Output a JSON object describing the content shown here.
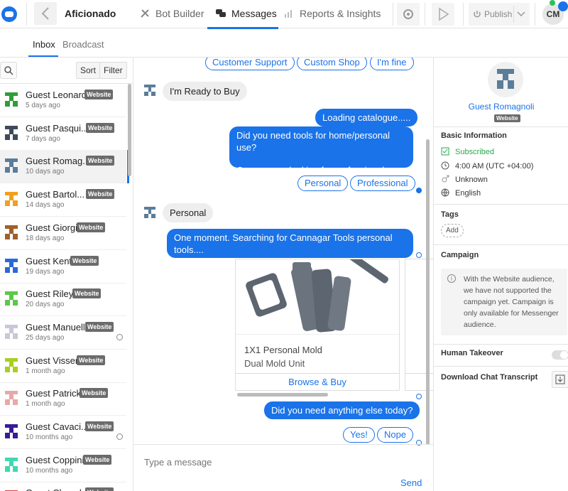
{
  "topbar": {
    "app_name": "Aficionado",
    "nav": [
      "Bot Builder",
      "Messages",
      "Reports & Insights"
    ],
    "publish_label": "Publish",
    "user_initials": "CM"
  },
  "subtabs": [
    "Inbox",
    "Broadcast"
  ],
  "list_tools": {
    "sort": "Sort",
    "filter": "Filter"
  },
  "conversations": [
    {
      "name": "Guest Leonard",
      "badge": "Website",
      "time": "5 days ago",
      "color": "#2e9e3a"
    },
    {
      "name": "Guest Pasqui...",
      "badge": "Website",
      "time": "7 days ago",
      "color": "#3f4a5c"
    },
    {
      "name": "Guest Romag...",
      "badge": "Website",
      "time": "10 days ago",
      "color": "#5a7d9a"
    },
    {
      "name": "Guest Bartol...",
      "badge": "Website",
      "time": "14 days ago",
      "color": "#f0a020"
    },
    {
      "name": "Guest Giorgi",
      "badge": "Website",
      "time": "18 days ago",
      "color": "#a0602a"
    },
    {
      "name": "Guest Kent",
      "badge": "Website",
      "time": "19 days ago",
      "color": "#2a6ad8"
    },
    {
      "name": "Guest Riley",
      "badge": "Website",
      "time": "20 days ago",
      "color": "#5cc84a"
    },
    {
      "name": "Guest Manuelli",
      "badge": "Website",
      "time": "25 days ago",
      "color": "#c8c8d8"
    },
    {
      "name": "Guest Visser",
      "badge": "Website",
      "time": "1 month ago",
      "color": "#a8d020"
    },
    {
      "name": "Guest Patrick",
      "badge": "Website",
      "time": "1 month ago",
      "color": "#e8a8a8"
    },
    {
      "name": "Guest Cavaci...",
      "badge": "Website",
      "time": "10 months ago",
      "color": "#3a1a9a"
    },
    {
      "name": "Guest Coppini",
      "badge": "Website",
      "time": "10 months ago",
      "color": "#40d8b0"
    },
    {
      "name": "Guest Cheval...",
      "badge": "Website",
      "time": "",
      "color": "#d84040"
    }
  ],
  "chat": {
    "top_replies": [
      "Customer Support",
      "Custom Shop",
      "I'm fine"
    ],
    "msg_ready": "I'm Ready to Buy",
    "out1": "Loading catalogue.....",
    "out2a": "Did you need tools for home/personal use?",
    "out2b": "Or were you looking for professional tools?",
    "replies2": [
      "Personal",
      "Professional"
    ],
    "msg_personal": "Personal",
    "out3": "One moment. Searching for Cannagar Tools personal tools....",
    "card": {
      "title": "1X1 Personal Mold",
      "subtitle": "Dual Mold Unit",
      "button": "Browse & Buy"
    },
    "out4": "Did you need anything else today?",
    "replies3": [
      "Yes!",
      "Nope"
    ],
    "placeholder": "Type a message",
    "send": "Send"
  },
  "profile": {
    "name": "Guest Romagnoli",
    "badge": "Website",
    "basic_title": "Basic Information",
    "subscribed": "Subscribed",
    "timezone": "4:00 AM (UTC +04:00)",
    "gender": "Unknown",
    "language": "English",
    "tags_title": "Tags",
    "add_tag": "Add",
    "campaign_title": "Campaign",
    "campaign_info": "With the Website audience, we have not supported the campaign yet. Campaign is only available for Messenger audience.",
    "takeover": "Human Takeover",
    "transcript": "Download Chat Transcript",
    "subscribed_color": "#29a84a"
  }
}
